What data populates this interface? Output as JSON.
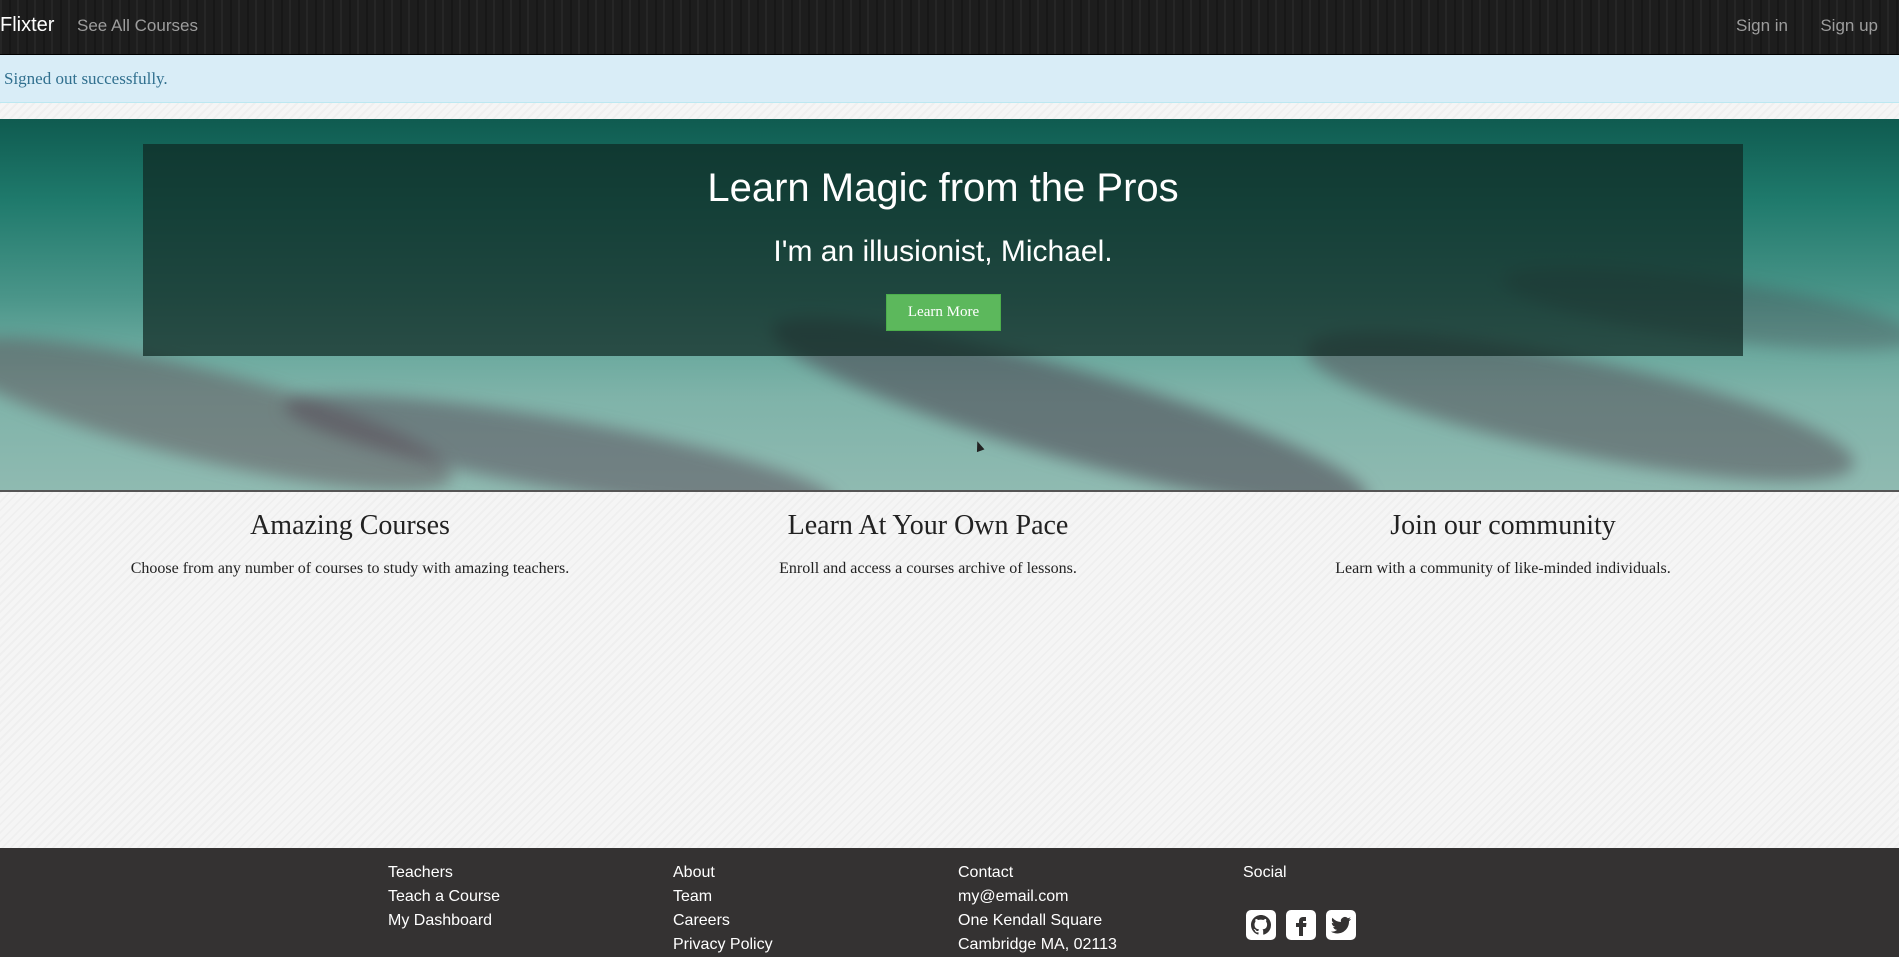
{
  "navbar": {
    "brand": "Flixter",
    "see_all_courses": "See All Courses",
    "sign_in": "Sign in",
    "sign_up": "Sign up"
  },
  "alert": {
    "message": "Signed out successfully."
  },
  "hero": {
    "title": "Learn Magic from the Pros",
    "subtitle": "I'm an illusionist, Michael.",
    "button_label": "Learn More"
  },
  "features": [
    {
      "title": "Amazing Courses",
      "text": "Choose from any number of courses to study with amazing teachers."
    },
    {
      "title": "Learn At Your Own Pace",
      "text": "Enroll and access a courses archive of lessons."
    },
    {
      "title": "Join our community",
      "text": "Learn with a community of like-minded individuals."
    }
  ],
  "footer": {
    "teachers": {
      "heading": "Teachers",
      "links": [
        "Teach a Course",
        "My Dashboard"
      ]
    },
    "about": {
      "heading": "About",
      "links": [
        "Team",
        "Careers",
        "Privacy Policy"
      ]
    },
    "contact": {
      "heading": "Contact",
      "lines": [
        "my@email.com",
        "One Kendall Square",
        "Cambridge MA, 02113"
      ]
    },
    "social": {
      "heading": "Social",
      "icons": [
        "github-icon",
        "facebook-icon",
        "twitter-icon"
      ]
    }
  },
  "colors": {
    "navbar_bg": "#1d1d1d",
    "alert_bg": "#d9edf7",
    "alert_text": "#31708f",
    "button_green": "#5cb85c",
    "footer_bg": "#343232"
  }
}
